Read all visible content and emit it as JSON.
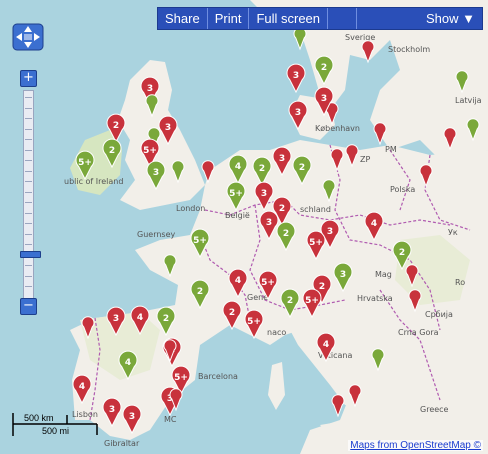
{
  "toolbar": {
    "share_label": "Share",
    "print_label": "Print",
    "fullscreen_label": "Full screen",
    "show_label": "Show ▼"
  },
  "zoom": {
    "plus": "+",
    "minus": "−",
    "level_fraction": 0.8
  },
  "scale": {
    "km": "500 km",
    "mi": "500 mi"
  },
  "attribution": "Maps from OpenStreetMap ©",
  "colors": {
    "sea": "#aad3df",
    "land": "#f2efe9",
    "land_green": "#d6e6c0",
    "border": "#b05bb0",
    "toolbar": "#2a4fb8",
    "marker_red": "#c8323c",
    "marker_green": "#7aa83a"
  },
  "place_labels": [
    {
      "key": "sverige",
      "text": "Sverige"
    },
    {
      "key": "stockholm",
      "text": "Stockholm"
    },
    {
      "key": "latvija",
      "text": "Latvija"
    },
    {
      "key": "kobenhavn",
      "text": "København"
    },
    {
      "key": "ublic_of_ireland",
      "text": "ublic of Ireland"
    },
    {
      "key": "london",
      "text": "London"
    },
    {
      "key": "belgie",
      "text": "België"
    },
    {
      "key": "schland",
      "text": "schland"
    },
    {
      "key": "polska",
      "text": "Polska"
    },
    {
      "key": "zp",
      "text": "ZP"
    },
    {
      "key": "pm",
      "text": "PM"
    },
    {
      "key": "guernsey",
      "text": "Guernsey"
    },
    {
      "key": "magy",
      "text": "Mag"
    },
    {
      "key": "hrvatska",
      "text": "Hrvatska"
    },
    {
      "key": "srbija",
      "text": "Србија"
    },
    {
      "key": "gene",
      "text": "Gene"
    },
    {
      "key": "naco",
      "text": "naco"
    },
    {
      "key": "crna_gora",
      "text": "Crna\nGora"
    },
    {
      "key": "vaticana",
      "text": "Vaticana"
    },
    {
      "key": "barcelona",
      "text": "Barcelona"
    },
    {
      "key": "lisbon",
      "text": "Lisbon"
    },
    {
      "key": "gibraltar",
      "text": "Gibraltar"
    },
    {
      "key": "greece",
      "text": "Greece"
    },
    {
      "key": "mc",
      "text": "MC"
    },
    {
      "key": "ukraina",
      "text": "Ук"
    },
    {
      "key": "romania",
      "text": "Ro"
    }
  ],
  "markers": [
    {
      "color": "green",
      "label": ""
    },
    {
      "color": "red",
      "label": ""
    },
    {
      "color": "red",
      "label": "3"
    },
    {
      "color": "green",
      "label": ""
    },
    {
      "color": "red",
      "label": "3"
    },
    {
      "color": "green",
      "label": "2"
    },
    {
      "color": "red",
      "label": "3"
    },
    {
      "color": "red",
      "label": ""
    },
    {
      "color": "green",
      "label": ""
    },
    {
      "color": "red",
      "label": "3"
    },
    {
      "color": "red",
      "label": "2"
    },
    {
      "color": "red",
      "label": "3"
    },
    {
      "color": "green",
      "label": ""
    },
    {
      "color": "red",
      "label": "5+"
    },
    {
      "color": "green",
      "label": "5+"
    },
    {
      "color": "green",
      "label": "2"
    },
    {
      "color": "green",
      "label": "3"
    },
    {
      "color": "green",
      "label": ""
    },
    {
      "color": "red",
      "label": ""
    },
    {
      "color": "green",
      "label": "4"
    },
    {
      "color": "green",
      "label": "2"
    },
    {
      "color": "red",
      "label": "3"
    },
    {
      "color": "green",
      "label": "2"
    },
    {
      "color": "red",
      "label": ""
    },
    {
      "color": "red",
      "label": ""
    },
    {
      "color": "green",
      "label": "5+"
    },
    {
      "color": "red",
      "label": "3"
    },
    {
      "color": "red",
      "label": "2"
    },
    {
      "color": "green",
      "label": ""
    },
    {
      "color": "red",
      "label": ""
    },
    {
      "color": "green",
      "label": "5+"
    },
    {
      "color": "red",
      "label": "3"
    },
    {
      "color": "green",
      "label": "2"
    },
    {
      "color": "red",
      "label": "5+"
    },
    {
      "color": "red",
      "label": "3"
    },
    {
      "color": "red",
      "label": "4"
    },
    {
      "color": "green",
      "label": "2"
    },
    {
      "color": "red",
      "label": ""
    },
    {
      "color": "green",
      "label": "2"
    },
    {
      "color": "red",
      "label": "4"
    },
    {
      "color": "red",
      "label": "5+"
    },
    {
      "color": "green",
      "label": "3"
    },
    {
      "color": "red",
      "label": "2"
    },
    {
      "color": "red",
      "label": "5+"
    },
    {
      "color": "red",
      "label": ""
    },
    {
      "color": "red",
      "label": "2"
    },
    {
      "color": "red",
      "label": "5+"
    },
    {
      "color": "green",
      "label": ""
    },
    {
      "color": "green",
      "label": "2"
    },
    {
      "color": "red",
      "label": "3"
    },
    {
      "color": "red",
      "label": "4"
    },
    {
      "color": "green",
      "label": "2"
    },
    {
      "color": "red",
      "label": ""
    },
    {
      "color": "green",
      "label": "4"
    },
    {
      "color": "red",
      "label": "2"
    },
    {
      "color": "red",
      "label": "3"
    },
    {
      "color": "red",
      "label": ""
    },
    {
      "color": "red",
      "label": "4"
    },
    {
      "color": "red",
      "label": "5+"
    },
    {
      "color": "red",
      "label": "3"
    },
    {
      "color": "red",
      "label": "3"
    },
    {
      "color": "red",
      "label": "4"
    },
    {
      "color": "green",
      "label": ""
    },
    {
      "color": "red",
      "label": ""
    },
    {
      "color": "red",
      "label": ""
    },
    {
      "color": "green",
      "label": ""
    },
    {
      "color": "red",
      "label": ""
    },
    {
      "color": "red",
      "label": ""
    },
    {
      "color": "green",
      "label": ""
    },
    {
      "color": "red",
      "label": ""
    }
  ]
}
